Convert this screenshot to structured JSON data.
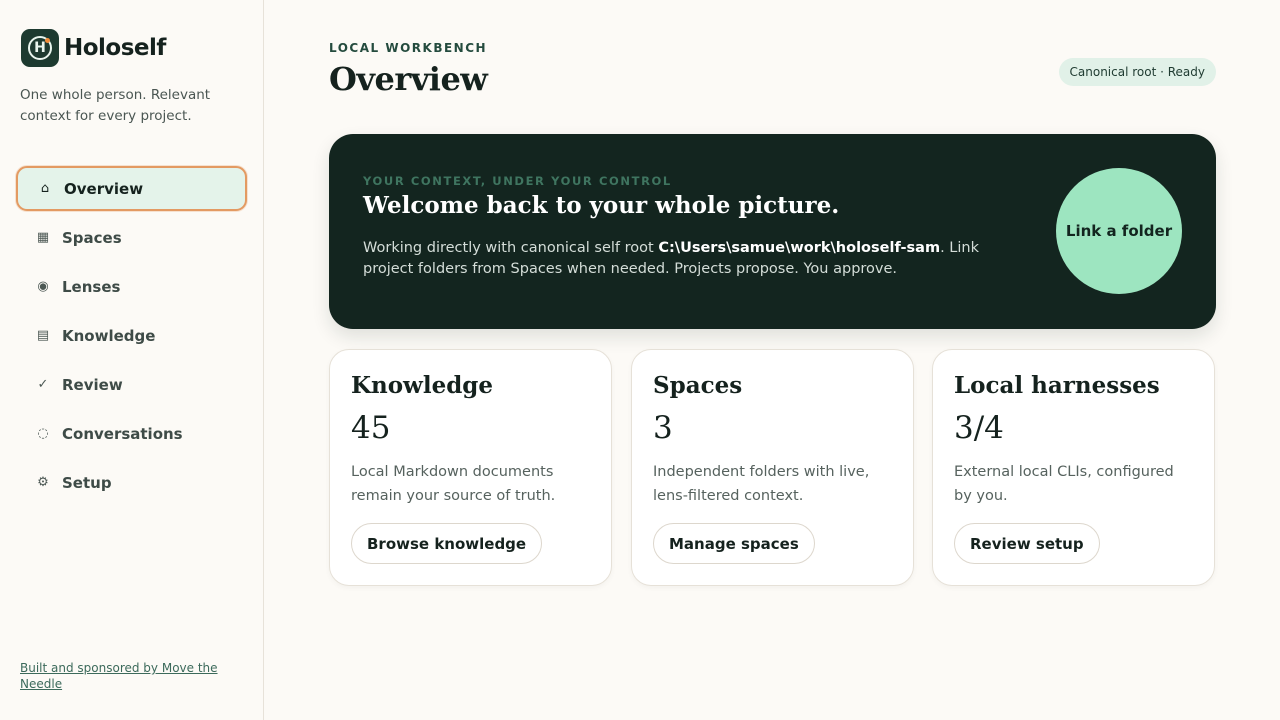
{
  "sidebar": {
    "brand_letter": "H",
    "brand_name": "Holoself",
    "tagline": "One whole person. Relevant context for every project.",
    "items": [
      {
        "label": "Overview",
        "icon": "⌂",
        "icon_name": "home-icon",
        "active": true
      },
      {
        "label": "Spaces",
        "icon": "▦",
        "icon_name": "grid-icon"
      },
      {
        "label": "Lenses",
        "icon": "◉",
        "icon_name": "lens-icon"
      },
      {
        "label": "Knowledge",
        "icon": "▤",
        "icon_name": "document-icon"
      },
      {
        "label": "Review",
        "icon": "✓",
        "icon_name": "check-icon"
      },
      {
        "label": "Conversations",
        "icon": "◌",
        "icon_name": "chat-icon"
      },
      {
        "label": "Setup",
        "icon": "⚙",
        "icon_name": "gear-icon"
      }
    ],
    "footer_link": "Built and sponsored by Move the Needle"
  },
  "header": {
    "eyebrow": "LOCAL WORKBENCH",
    "title": "Overview",
    "status": "Canonical root · Ready"
  },
  "hero": {
    "eyebrow": "YOUR CONTEXT, UNDER YOUR CONTROL",
    "title": "Welcome back to your whole picture.",
    "text_before": "Working directly with canonical self root ",
    "path": "C:\\Users\\samue\\work\\holoself-sam",
    "text_after": ". Link project folders from Spaces when needed. Projects propose. You approve.",
    "button": "Link a folder"
  },
  "cards": [
    {
      "title": "Knowledge",
      "count": "45",
      "desc": "Local Markdown documents remain your source of truth.",
      "button": "Browse knowledge"
    },
    {
      "title": "Spaces",
      "count": "3",
      "desc": "Independent folders with live, lens-filtered context.",
      "button": "Manage spaces"
    },
    {
      "title": "Local harnesses",
      "count": "3/4",
      "desc": "External local CLIs, configured by you.",
      "button": "Review setup"
    }
  ],
  "colors": {
    "accent": "#9de5c0",
    "hero_bg": "#13251f",
    "active_border": "#e39a62",
    "active_bg": "#e4f3ea"
  }
}
